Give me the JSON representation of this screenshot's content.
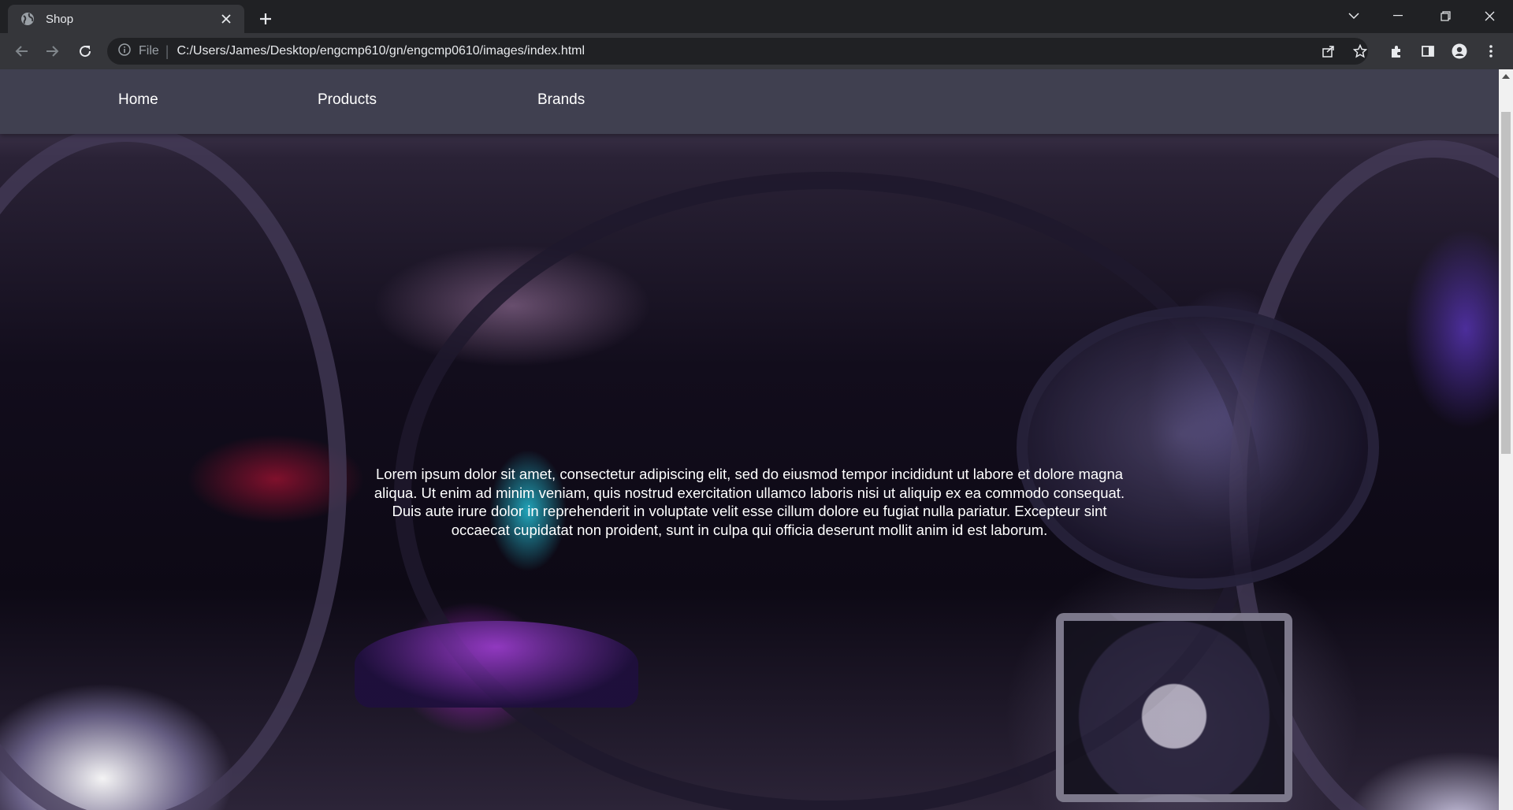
{
  "browser": {
    "tab": {
      "title": "Shop",
      "favicon": "globe-icon"
    },
    "address_bar": {
      "scheme_label": "File",
      "url": "C:/Users/James/Desktop/engcmp610/gn/engcmp0610/images/index.html"
    },
    "colors": {
      "tabstrip": "#202124",
      "toolbar": "#35363a",
      "omnibox": "#202124",
      "icon": "#e8eaed"
    }
  },
  "page": {
    "nav": {
      "items": [
        {
          "label": "Home"
        },
        {
          "label": "Products"
        },
        {
          "label": "Brands"
        }
      ],
      "background": "#404050"
    },
    "hero": {
      "text": "Lorem ipsum dolor sit amet, consectetur adipiscing elit, sed do eiusmod tempor incididunt ut labore et dolore magna aliqua. Ut enim ad minim veniam, quis nostrud exercitation ullamco laboris nisi ut aliquip ex ea commodo consequat. Duis aute irure dolor in reprehenderit in voluptate velit esse cillum dolore eu fugiat nulla pariatur. Excepteur sint occaecat cupidatat non proident, sunt in culpa qui officia deserunt mollit anim id est laborum.",
      "background_description_icon": "pc-case-photo"
    }
  }
}
